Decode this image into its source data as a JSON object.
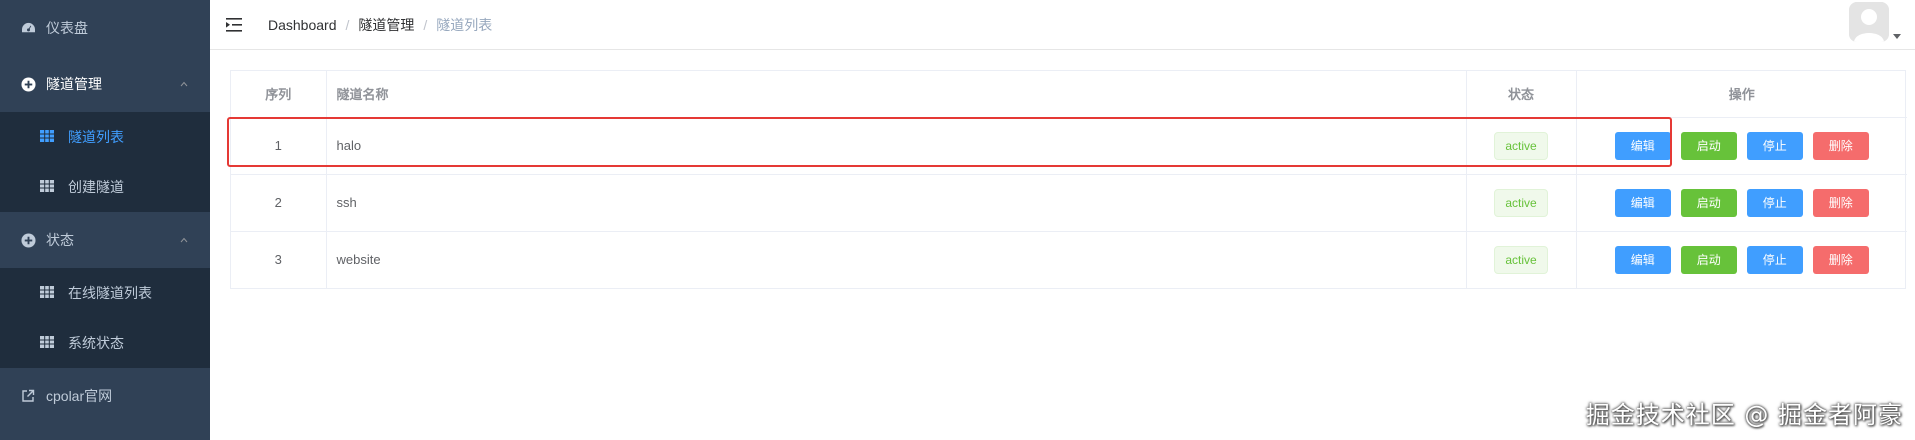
{
  "sidebar": {
    "items": [
      {
        "label": "仪表盘",
        "icon": "dashboard-icon"
      },
      {
        "label": "隧道管理",
        "icon": "plus-circle-icon",
        "expanded": true,
        "children": [
          {
            "label": "隧道列表",
            "icon": "grid-icon",
            "active": true
          },
          {
            "label": "创建隧道",
            "icon": "grid-icon"
          }
        ]
      },
      {
        "label": "状态",
        "icon": "plus-circle-icon",
        "expanded": true,
        "children": [
          {
            "label": "在线隧道列表",
            "icon": "grid-icon"
          },
          {
            "label": "系统状态",
            "icon": "grid-icon"
          }
        ]
      },
      {
        "label": "cpolar官网",
        "icon": "external-link-icon"
      }
    ]
  },
  "header": {
    "breadcrumb": [
      "Dashboard",
      "隧道管理",
      "隧道列表"
    ]
  },
  "table": {
    "columns": [
      "序列",
      "隧道名称",
      "状态",
      "操作"
    ],
    "rows": [
      {
        "index": "1",
        "name": "halo",
        "status": "active"
      },
      {
        "index": "2",
        "name": "ssh",
        "status": "active"
      },
      {
        "index": "3",
        "name": "website",
        "status": "active"
      }
    ],
    "actions": {
      "edit": "编辑",
      "start": "启动",
      "stop": "停止",
      "delete": "删除"
    }
  },
  "colors": {
    "sidebar_bg": "#304156",
    "submenu_bg": "#1f2d3d",
    "active": "#409eff",
    "success": "#67c23a",
    "danger": "#f56c6c",
    "highlight": "#e53935"
  },
  "watermark": "掘金技术社区 @ 掘金者阿豪"
}
